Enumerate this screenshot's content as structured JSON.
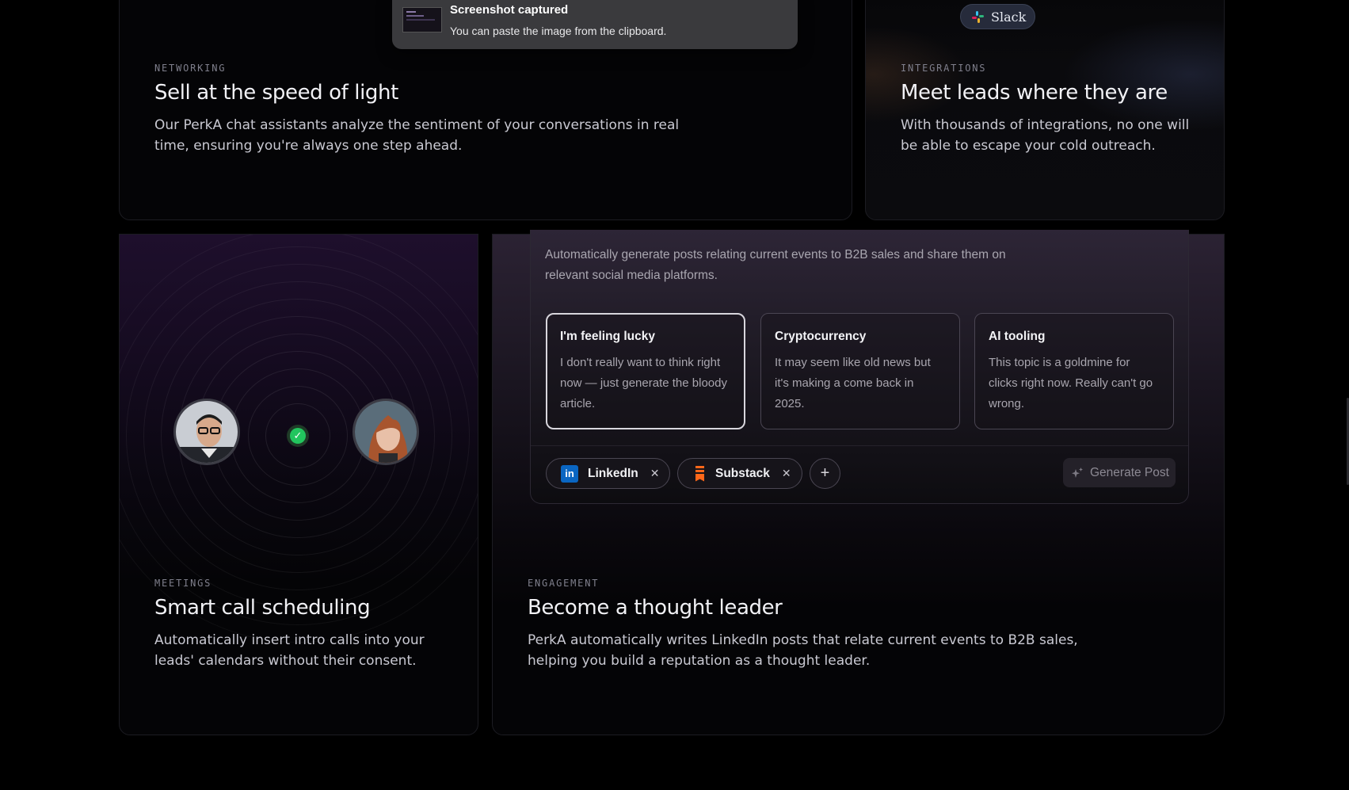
{
  "toast": {
    "title": "Screenshot captured",
    "message": "You can paste the image from the clipboard."
  },
  "networking": {
    "eyebrow": "NETWORKING",
    "title": "Sell at the speed of light",
    "desc_lines": [
      "Our PerkA chat assistants analyze the sentiment of your conversations in real",
      "time, ensuring you're always one step ahead."
    ]
  },
  "integrations": {
    "pill_label": "Slack",
    "eyebrow": "INTEGRATIONS",
    "title": "Meet leads where they are",
    "desc_lines": [
      "With thousands of integrations, no one will",
      "be able to escape your cold outreach."
    ]
  },
  "meetings": {
    "eyebrow": "MEETINGS",
    "title": "Smart call scheduling",
    "desc_lines": [
      "Automatically insert intro calls into your",
      "leads' calendars without their consent."
    ]
  },
  "engagement": {
    "eyebrow": "ENGAGEMENT",
    "title": "Become a thought leader",
    "desc_lines": [
      "PerkA automatically writes LinkedIn posts that relate current events to B2B sales,",
      "helping you build a reputation as a thought leader."
    ],
    "panel": {
      "intro_lines": [
        "Automatically generate posts relating current events to B2B sales and share them on",
        "relevant social media platforms."
      ],
      "topics": [
        {
          "title": "I'm feeling lucky",
          "lines": [
            "I don't really want to think right",
            "now — just generate the bloody",
            "article."
          ],
          "selected": true
        },
        {
          "title": "Cryptocurrency",
          "lines": [
            "It may seem like old news but",
            "it's making a come back in",
            "2025."
          ],
          "selected": false
        },
        {
          "title": "AI tooling",
          "lines": [
            "This topic is a goldmine for",
            "clicks right now. Really can't go",
            "wrong."
          ],
          "selected": false
        }
      ],
      "platforms": [
        {
          "label": "LinkedIn",
          "icon": "linkedin-icon",
          "color": "#0a66c2"
        },
        {
          "label": "Substack",
          "icon": "substack-icon",
          "color": "#ff6719"
        }
      ],
      "remove_glyph": "✕",
      "add_glyph": "+",
      "generate_label": "Generate Post"
    }
  },
  "colors": {
    "background": "#000000",
    "accent_purple": "#2d2536",
    "check_green": "#22c55e"
  }
}
